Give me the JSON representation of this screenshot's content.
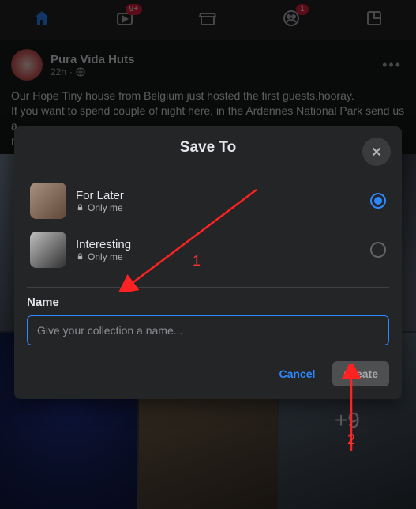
{
  "nav": {
    "video_badge": "9+",
    "group_badge": "1"
  },
  "post": {
    "authorName": "Pura Vida Huts",
    "time": "22h",
    "text1": "Our Hope Tiny house from Belgium just hosted the first guests,hooray.",
    "text2": "If you want to spend couple of night here, in the Ardennes National Park send us a",
    "text3": "n",
    "moreCount": "+9"
  },
  "modal": {
    "title": "Save To",
    "collections": [
      {
        "name": "For Later",
        "privacy": "Only me",
        "selected": true
      },
      {
        "name": "Interesting",
        "privacy": "Only me",
        "selected": false
      }
    ],
    "nameLabel": "Name",
    "placeholder": "Give your collection a name...",
    "cancelLabel": "Cancel",
    "createLabel": "Create"
  },
  "annotations": {
    "label1": "1",
    "label2": "2"
  }
}
